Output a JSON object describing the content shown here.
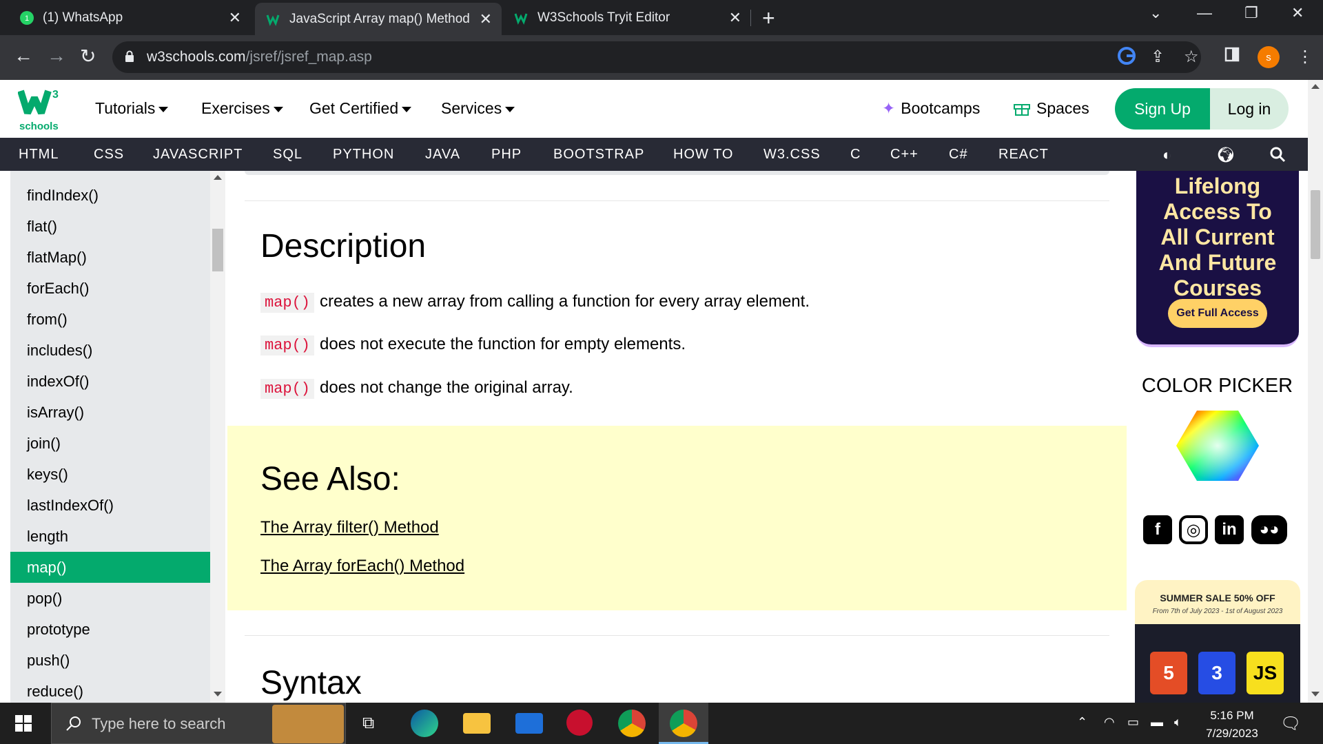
{
  "browser": {
    "tabs": [
      {
        "title": "(1) WhatsApp",
        "icon": "whatsapp-icon"
      },
      {
        "title": "JavaScript Array map() Method",
        "icon": "w3schools-icon",
        "active": true
      },
      {
        "title": "W3Schools Tryit Editor",
        "icon": "w3schools-icon"
      }
    ],
    "url_domain": "w3schools.com",
    "url_path": "/jsref/jsref_map.asp",
    "profile_initial": "s"
  },
  "topnav": {
    "logo_text": "schools",
    "items": [
      "Tutorials",
      "Exercises",
      "Get Certified",
      "Services"
    ],
    "bootcamps": "Bootcamps",
    "spaces": "Spaces",
    "signup": "Sign Up",
    "login": "Log in"
  },
  "subnav": {
    "items": [
      "HTML",
      "CSS",
      "JAVASCRIPT",
      "SQL",
      "PYTHON",
      "JAVA",
      "PHP",
      "BOOTSTRAP",
      "HOW TO",
      "W3.CSS",
      "C",
      "C++",
      "C#",
      "REACT"
    ]
  },
  "sidebar": {
    "items": [
      "findIndex()",
      "flat()",
      "flatMap()",
      "forEach()",
      "from()",
      "includes()",
      "indexOf()",
      "isArray()",
      "join()",
      "keys()",
      "lastIndexOf()",
      "length",
      "map()",
      "pop()",
      "prototype",
      "push()",
      "reduce()"
    ],
    "active": "map()"
  },
  "main": {
    "description_heading": "Description",
    "lines": [
      {
        "code": "map()",
        "text": "creates a new array from calling a function for every array element."
      },
      {
        "code": "map()",
        "text": "does not execute the function for empty elements."
      },
      {
        "code": "map()",
        "text": "does not change the original array."
      }
    ],
    "see_also_heading": "See Also:",
    "see_also_links": [
      "The Array filter() Method",
      "The Array forEach() Method"
    ],
    "syntax_heading": "Syntax"
  },
  "right": {
    "ad1_lines": [
      "Lifelong",
      "Access To",
      "All Current",
      "And Future",
      "Courses"
    ],
    "ad1_button": "Get Full Access",
    "color_picker": "COLOR PICKER",
    "ad2_title": "SUMMER SALE 50% OFF",
    "ad2_subtitle": "From 7th of July 2023 - 1st of August 2023",
    "badges": [
      "5",
      "3",
      "JS"
    ]
  },
  "taskbar": {
    "search_placeholder": "Type here to search",
    "time": "5:16 PM",
    "date": "7/29/2023"
  },
  "colors": {
    "accent": "#04aa6d",
    "subnav_bg": "#282a35",
    "code_red": "#dc143c",
    "see_also_bg": "#ffffcc"
  }
}
